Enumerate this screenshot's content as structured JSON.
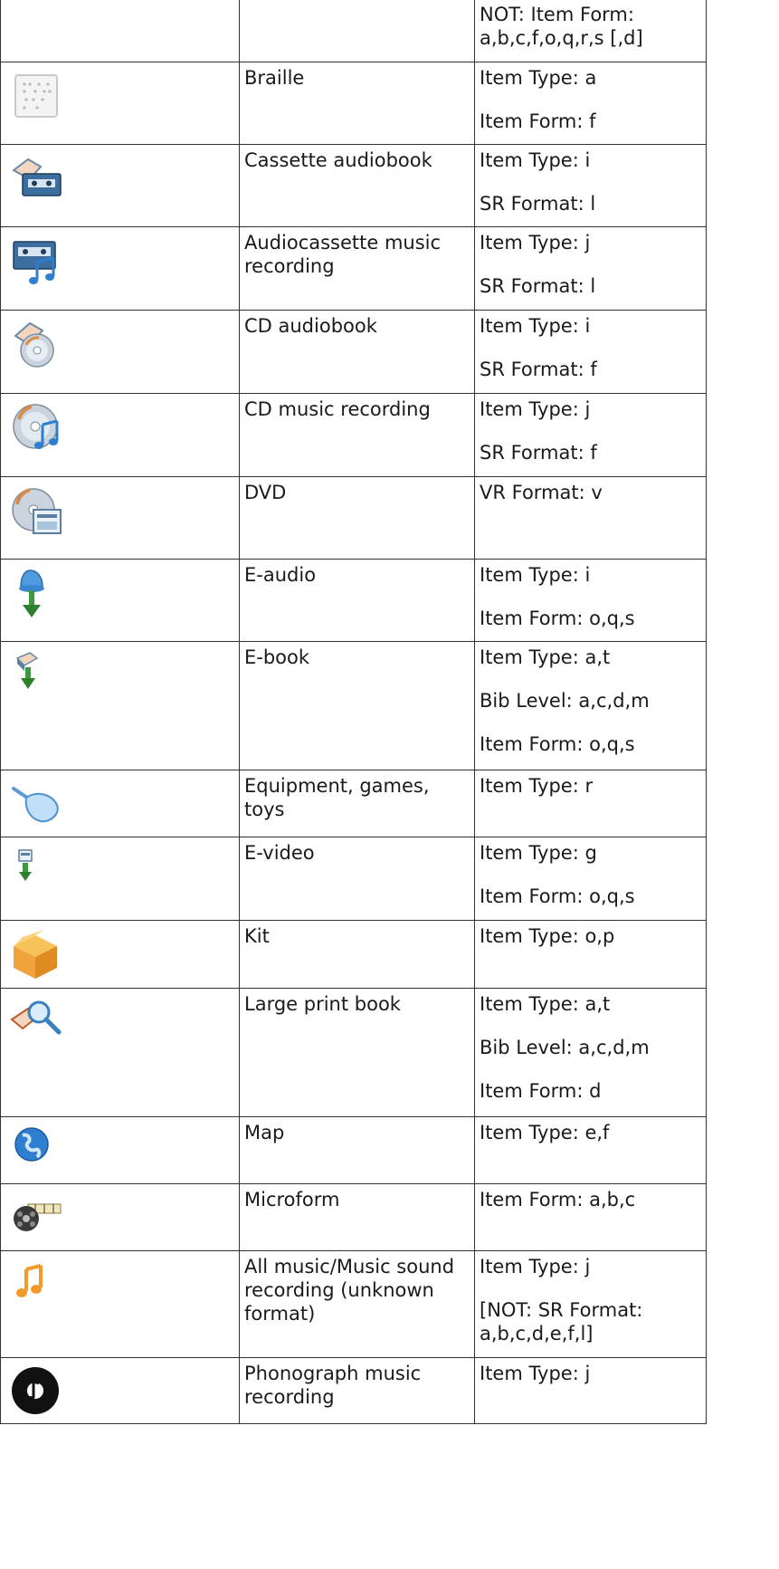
{
  "rows": [
    {
      "icon": "none",
      "label": "",
      "criteria": [
        "NOT: Item Form: a,b,c,f,o,q,r,s [,d]"
      ]
    },
    {
      "icon": "braille-icon",
      "label": "Braille",
      "criteria": [
        "Item Type: a",
        "Item Form: f"
      ]
    },
    {
      "icon": "cassette-audiobook-icon",
      "label": "Cassette audiobook",
      "criteria": [
        "Item Type: i",
        "SR Format: l"
      ]
    },
    {
      "icon": "audiocassette-music-icon",
      "label": "Audiocassette music recording",
      "criteria": [
        "Item Type: j",
        "SR Format: l"
      ]
    },
    {
      "icon": "cd-audiobook-icon",
      "label": "CD audiobook",
      "criteria": [
        "Item Type: i",
        "SR Format: f"
      ]
    },
    {
      "icon": "cd-music-icon",
      "label": "CD music recording",
      "criteria": [
        "Item Type: j",
        "SR Format: f"
      ]
    },
    {
      "icon": "dvd-icon",
      "label": "DVD",
      "criteria": [
        "VR Format: v"
      ]
    },
    {
      "icon": "e-audio-icon",
      "label": "E-audio",
      "criteria": [
        "Item Type: i",
        "Item Form: o,q,s"
      ]
    },
    {
      "icon": "e-book-icon",
      "label": "E-book",
      "criteria": [
        "Item Type: a,t",
        "Bib Level: a,c,d,m",
        "Item Form: o,q,s"
      ]
    },
    {
      "icon": "equipment-icon",
      "label": "Equipment, games, toys",
      "criteria": [
        "Item Type: r"
      ]
    },
    {
      "icon": "e-video-icon",
      "label": "E-video",
      "criteria": [
        "Item Type: g",
        "Item Form: o,q,s"
      ]
    },
    {
      "icon": "kit-icon",
      "label": "Kit",
      "criteria": [
        "Item Type: o,p"
      ]
    },
    {
      "icon": "large-print-icon",
      "label": "Large print book",
      "criteria": [
        "Item Type: a,t",
        "Bib Level: a,c,d,m",
        "Item Form: d"
      ]
    },
    {
      "icon": "map-icon",
      "label": "Map",
      "criteria": [
        "Item Type: e,f"
      ]
    },
    {
      "icon": "microform-icon",
      "label": "Microform",
      "criteria": [
        "Item Form: a,b,c"
      ]
    },
    {
      "icon": "music-note-icon",
      "label": "All music/Music sound recording (unknown format)",
      "criteria": [
        "Item Type: j",
        "[NOT: SR Format: a,b,c,d,e,f,l]"
      ]
    },
    {
      "icon": "phonograph-icon",
      "label": "Phonograph music recording",
      "criteria": [
        "Item Type: j"
      ]
    }
  ]
}
